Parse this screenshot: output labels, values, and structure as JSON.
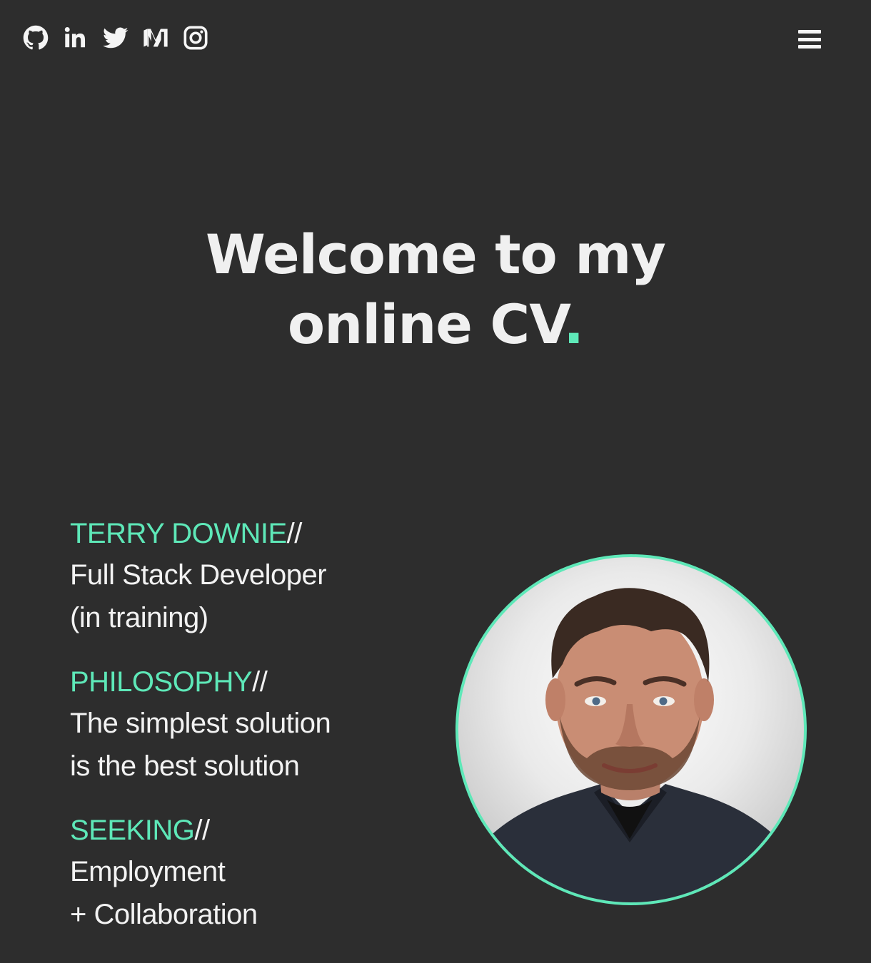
{
  "header": {
    "social_icons": [
      "github-icon",
      "linkedin-icon",
      "twitter-icon",
      "medium-icon",
      "instagram-icon"
    ],
    "menu_icon": "hamburger-menu-icon"
  },
  "hero": {
    "title_line1": "Welcome to my",
    "title_line2": "online CV",
    "title_dot": "."
  },
  "profile": {
    "name": {
      "key": "TERRY DOWNIE",
      "sep": "//",
      "lines": [
        "Full Stack Developer",
        "(in training)"
      ]
    },
    "philosophy": {
      "key": "PHILOSOPHY",
      "sep": "//",
      "lines": [
        "The simplest solution",
        "is the best solution"
      ]
    },
    "seeking": {
      "key": "SEEKING",
      "sep": "//",
      "lines": [
        "Employment",
        "+ Collaboration"
      ]
    }
  },
  "colors": {
    "background": "#2d2d2d",
    "accent": "#5ee8b8",
    "text": "#f2f2f2"
  }
}
